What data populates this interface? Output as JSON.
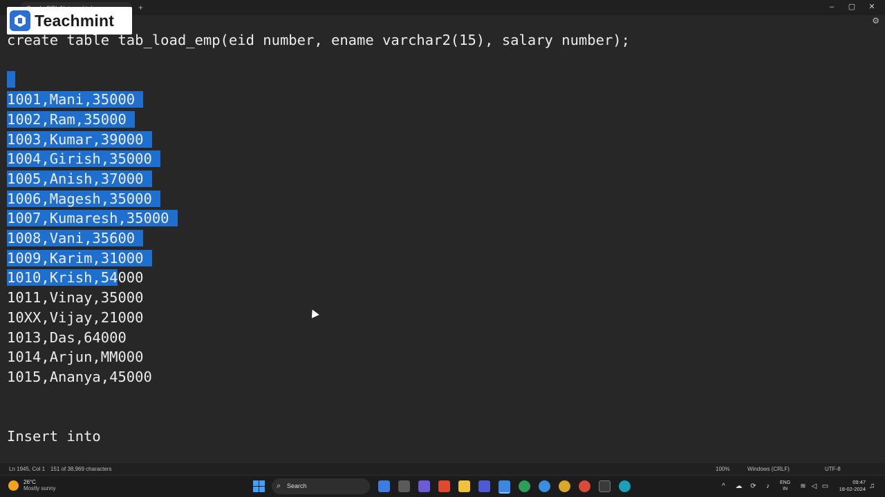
{
  "titlebar": {
    "tab_label": "Oracle SQL Notepad tab",
    "new_tab": "+",
    "minimize": "–",
    "maximize": "▢",
    "close": "✕"
  },
  "logo": {
    "text": "Teachmint"
  },
  "editor": {
    "lines": [
      {
        "text": "create table tab_load_emp(eid number, ename varchar2(15), salary number);"
      },
      {
        "text": ""
      },
      {
        "text": " "
      },
      {
        "text": "1001,Mani,35000 "
      },
      {
        "text": "1002,Ram,35000 "
      },
      {
        "text": "1003,Kumar,39000 "
      },
      {
        "text": "1004,Girish,35000 "
      },
      {
        "text": "1005,Anish,37000 "
      },
      {
        "text": "1006,Magesh,35000 "
      },
      {
        "text": "1007,Kumaresh,35000 "
      },
      {
        "text": "1008,Vani,35600 "
      },
      {
        "text": "1009,Karim,31000 "
      },
      {
        "text": "1010,Krish,54",
        "rest": "000"
      },
      {
        "text": "1011,Vinay,35000"
      },
      {
        "text": "10XX,Vijay,21000"
      },
      {
        "text": "1013,Das,64000"
      },
      {
        "text": "1014,Arjun,MM000"
      },
      {
        "text": "1015,Ananya,45000"
      },
      {
        "text": ""
      },
      {
        "text": ""
      },
      {
        "text": "Insert into"
      }
    ]
  },
  "statusbar": {
    "position": "Ln 1945, Col 1",
    "selection": "151 of 38,969 characters",
    "zoom": "100%",
    "line_endings": "Windows (CRLF)",
    "encoding": "UTF-8"
  },
  "taskbar": {
    "temperature": "26°C",
    "weather": "Mostly sunny",
    "search_label": "Search",
    "language_1": "ENG",
    "language_2": "IN",
    "time": "09:47",
    "date": "18-02-2024"
  },
  "colors": {
    "background": "#272727",
    "selection": "#1f6fcf",
    "text": "#ececec"
  }
}
